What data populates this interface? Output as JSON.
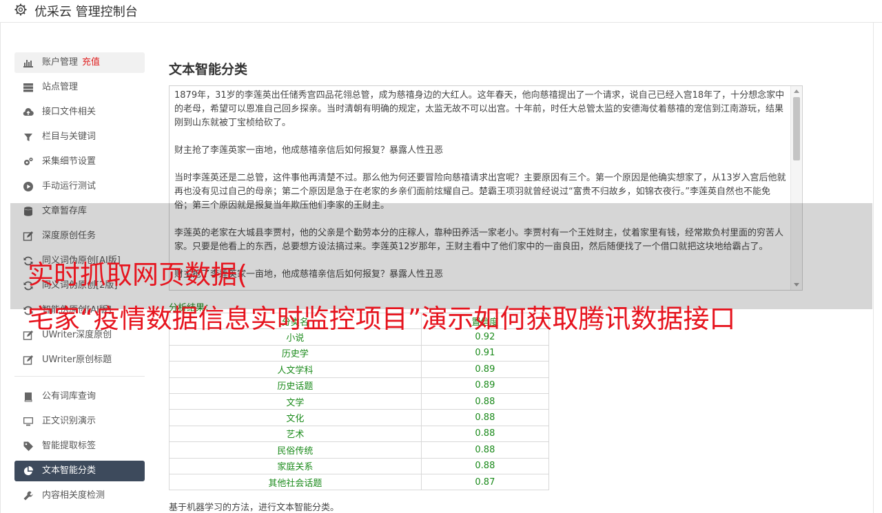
{
  "header": {
    "title": "优采云 管理控制台",
    "icon": "gear-icon"
  },
  "sidebar": {
    "items": [
      {
        "label": "账户管理",
        "extra": "充值",
        "icon": "bar-chart-icon",
        "state": "hover"
      },
      {
        "label": "站点管理",
        "icon": "server-icon"
      },
      {
        "label": "接口文件相关",
        "icon": "cloud-upload-icon"
      },
      {
        "label": "栏目与关键词",
        "icon": "filter-icon"
      },
      {
        "label": "采集细节设置",
        "icon": "gears-icon"
      },
      {
        "label": "手动运行测试",
        "icon": "play-circle-icon"
      },
      {
        "label": "文章暂存库",
        "icon": "database-icon"
      },
      {
        "label": "深度原创任务",
        "icon": "edit-icon"
      },
      {
        "label": "同义词伪原创[AI版]",
        "icon": "refresh-icon"
      },
      {
        "label": "同义词伪原创[2版]",
        "icon": "refresh-icon"
      },
      {
        "label": "智能伪原创[AI版]",
        "icon": "refresh-icon"
      },
      {
        "label": "UWriter深度原创",
        "icon": "edit-icon"
      },
      {
        "label": "UWriter原创标题",
        "icon": "edit-icon"
      }
    ],
    "items2": [
      {
        "label": "公有词库查询",
        "icon": "book-icon"
      },
      {
        "label": "正文识别演示",
        "icon": "monitor-icon"
      },
      {
        "label": "智能提取标签",
        "icon": "tag-icon"
      },
      {
        "label": "文本智能分类",
        "icon": "pie-chart-icon",
        "state": "active"
      },
      {
        "label": "内容相关度检测",
        "icon": "wrench-icon"
      }
    ]
  },
  "main": {
    "title": "文本智能分类",
    "textarea": {
      "paragraphs": [
        "1879年，31岁的李莲英出任储秀宫四品花翎总管，成为慈禧身边的大红人。这年春天，他向慈禧提出了一个请求，说自己已经入宫18年了，十分想念家中的老母，希望可以恩准自己回乡探亲。当时清朝有明确的规定，太监无故不可以出宫。十年前，时任大总管太监的安德海仗着慈禧的宠信到江南游玩，结果刚到山东就被丁宝桢给砍了。",
        "财主抢了李莲英家一亩地，他成慈禧亲信后如何报复？暴露人性丑恶",
        "当时李莲英还是二总管，这件事他再清楚不过。那么他为何还要冒险向慈禧请求出宫呢？主要原因有三个。第一个原因是他确实想家了，从13岁入宫后他就再也没有见过自己的母亲；第二个原因是急于在老家的乡亲们面前炫耀自己。楚霸王项羽就曾经说过“富贵不归故乡，如锦衣夜行。”李莲英自然也不能免俗；第三个原因就是报复当年欺压他们李家的王财主。",
        "李莲英的老家在大城县李贾村，他的父亲是个勤劳本分的庄稼人，靠种田养活一家老小。李贾村有一个王姓财主，仗着家里有钱，经常欺负村里面的穷苦人家。只要是他看上的东西，总要想方设法搞过来。李莲英12岁那年，王财主看中了他们家中的一亩良田，然后随便找了一个借口就把这块地给霸占了。",
        "财主抢了李莲英家一亩地，他成慈禧亲信后如何报复？暴露人性丑恶"
      ]
    },
    "result_label": "分析结果：",
    "table": {
      "headers": [
        "分类名",
        "置信度"
      ],
      "rows": [
        [
          "小说",
          "0.92"
        ],
        [
          "历史学",
          "0.91"
        ],
        [
          "人文学科",
          "0.89"
        ],
        [
          "历史话题",
          "0.89"
        ],
        [
          "文学",
          "0.88"
        ],
        [
          "文化",
          "0.88"
        ],
        [
          "艺术",
          "0.88"
        ],
        [
          "民俗传统",
          "0.88"
        ],
        [
          "家庭关系",
          "0.88"
        ],
        [
          "其他社会话题",
          "0.87"
        ]
      ]
    },
    "footnote": "基于机器学习的方法，进行文本智能分类。"
  },
  "overlay": {
    "line1": "实时抓取网页数据(",
    "line2": "宅家“疫情数据信息实时监控项目”演示如何获取腾讯数据接口"
  },
  "colors": {
    "active_nav_bg": "#3d4a5c",
    "result_green": "#1a8a1a",
    "overlay_red": "#e6141e",
    "extra_red": "#e02020"
  }
}
